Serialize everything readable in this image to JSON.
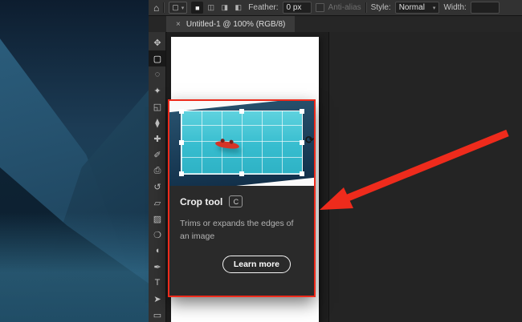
{
  "colors": {
    "annotation_red": "#ee2b1c",
    "canvas_bg": "#1e1e1e",
    "panel_bg": "#323232",
    "tooltip_bg": "#2a2a2a",
    "crop_preview_teal": "#37bdcf",
    "canoe_red": "#d63427"
  },
  "options_bar": {
    "home_icon": "⌂",
    "tool_preset_icon": "▢",
    "tool_preset_caret": "▾",
    "selection_modes": [
      {
        "name": "new-selection",
        "glyph": "■",
        "active": true
      },
      {
        "name": "add-to-selection",
        "glyph": "◫",
        "active": false
      },
      {
        "name": "subtract-from-selection",
        "glyph": "◨",
        "active": false
      },
      {
        "name": "intersect-selection",
        "glyph": "◧",
        "active": false
      }
    ],
    "feather_label": "Feather:",
    "feather_value": "0 px",
    "antialias_label": "Anti-alias",
    "style_label": "Style:",
    "style_value": "Normal",
    "style_caret": "▾",
    "width_label": "Width:",
    "width_value": ""
  },
  "tab_bar": {
    "close_icon": "×",
    "title": "Untitled-1 @ 100% (RGB/8)"
  },
  "toolbar": {
    "tools": [
      {
        "name": "move",
        "glyph": "✥",
        "selected": false
      },
      {
        "name": "rectangular-marquee",
        "glyph": "▢",
        "selected": true
      },
      {
        "name": "lasso",
        "glyph": "◌",
        "selected": false
      },
      {
        "name": "object-selection",
        "glyph": "✦",
        "selected": false
      },
      {
        "name": "crop",
        "glyph": "◱",
        "selected": false
      },
      {
        "name": "eyedropper",
        "glyph": "⧫",
        "selected": false
      },
      {
        "name": "spot-healing",
        "glyph": "✚",
        "selected": false
      },
      {
        "name": "brush",
        "glyph": "✐",
        "selected": false
      },
      {
        "name": "clone-stamp",
        "glyph": "⎙",
        "selected": false
      },
      {
        "name": "history-brush",
        "glyph": "↺",
        "selected": false
      },
      {
        "name": "eraser",
        "glyph": "▱",
        "selected": false
      },
      {
        "name": "gradient",
        "glyph": "▨",
        "selected": false
      },
      {
        "name": "blur",
        "glyph": "❍",
        "selected": false
      },
      {
        "name": "dodge",
        "glyph": "◖",
        "selected": false
      },
      {
        "name": "pen",
        "glyph": "✒",
        "selected": false
      },
      {
        "name": "type",
        "glyph": "T",
        "selected": false
      },
      {
        "name": "path-selection",
        "glyph": "➤",
        "selected": false
      },
      {
        "name": "rectangle-shape",
        "glyph": "▭",
        "selected": false
      }
    ]
  },
  "tooltip": {
    "title": "Crop tool",
    "shortcut_key": "C",
    "description": "Trims or expands the edges of an image",
    "learn_more_label": "Learn more",
    "rotate_cursor_icon": "⟳"
  }
}
